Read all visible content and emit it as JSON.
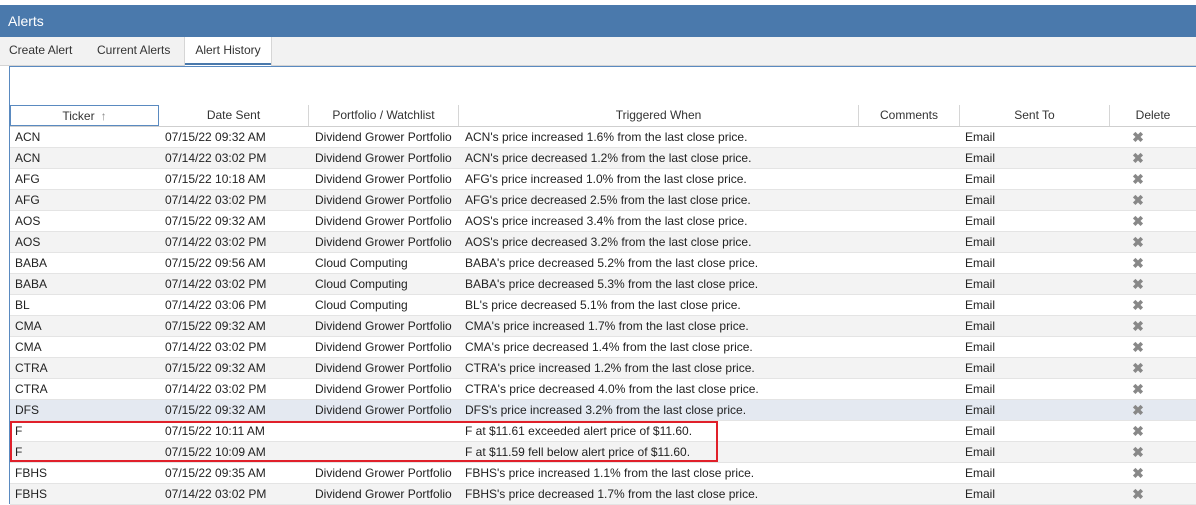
{
  "window": {
    "title": "Alerts"
  },
  "tabs": [
    {
      "label": "Create Alert",
      "active": false
    },
    {
      "label": "Current Alerts",
      "active": false
    },
    {
      "label": "Alert History",
      "active": true
    }
  ],
  "columns": {
    "ticker": "Ticker",
    "date_sent": "Date Sent",
    "portfolio": "Portfolio / Watchlist",
    "triggered": "Triggered When",
    "comments": "Comments",
    "sent_to": "Sent To",
    "delete": "Delete"
  },
  "sort": {
    "column": "Ticker",
    "direction": "ascending",
    "icon": "arrow-up-icon"
  },
  "delete_icon": "close-icon",
  "rows": [
    {
      "ticker": "ACN",
      "date": "07/15/22 09:32 AM",
      "portfolio": "Dividend Grower Portfolio",
      "triggered": "ACN's price increased 1.6% from the last close price.",
      "comments": "",
      "sent_to": "Email"
    },
    {
      "ticker": "ACN",
      "date": "07/14/22 03:02 PM",
      "portfolio": "Dividend Grower Portfolio",
      "triggered": "ACN's price decreased 1.2% from the last close price.",
      "comments": "",
      "sent_to": "Email"
    },
    {
      "ticker": "AFG",
      "date": "07/15/22 10:18 AM",
      "portfolio": "Dividend Grower Portfolio",
      "triggered": "AFG's price increased 1.0% from the last close price.",
      "comments": "",
      "sent_to": "Email"
    },
    {
      "ticker": "AFG",
      "date": "07/14/22 03:02 PM",
      "portfolio": "Dividend Grower Portfolio",
      "triggered": "AFG's price decreased 2.5% from the last close price.",
      "comments": "",
      "sent_to": "Email"
    },
    {
      "ticker": "AOS",
      "date": "07/15/22 09:32 AM",
      "portfolio": "Dividend Grower Portfolio",
      "triggered": "AOS's price increased 3.4% from the last close price.",
      "comments": "",
      "sent_to": "Email"
    },
    {
      "ticker": "AOS",
      "date": "07/14/22 03:02 PM",
      "portfolio": "Dividend Grower Portfolio",
      "triggered": "AOS's price decreased 3.2% from the last close price.",
      "comments": "",
      "sent_to": "Email"
    },
    {
      "ticker": "BABA",
      "date": "07/15/22 09:56 AM",
      "portfolio": "Cloud Computing",
      "triggered": "BABA's price decreased 5.2% from the last close price.",
      "comments": "",
      "sent_to": "Email"
    },
    {
      "ticker": "BABA",
      "date": "07/14/22 03:02 PM",
      "portfolio": "Cloud Computing",
      "triggered": "BABA's price decreased 5.3% from the last close price.",
      "comments": "",
      "sent_to": "Email"
    },
    {
      "ticker": "BL",
      "date": "07/14/22 03:06 PM",
      "portfolio": "Cloud Computing",
      "triggered": "BL's price decreased 5.1% from the last close price.",
      "comments": "",
      "sent_to": "Email"
    },
    {
      "ticker": "CMA",
      "date": "07/15/22 09:32 AM",
      "portfolio": "Dividend Grower Portfolio",
      "triggered": "CMA's price increased 1.7% from the last close price.",
      "comments": "",
      "sent_to": "Email"
    },
    {
      "ticker": "CMA",
      "date": "07/14/22 03:02 PM",
      "portfolio": "Dividend Grower Portfolio",
      "triggered": "CMA's price decreased 1.4% from the last close price.",
      "comments": "",
      "sent_to": "Email"
    },
    {
      "ticker": "CTRA",
      "date": "07/15/22 09:32 AM",
      "portfolio": "Dividend Grower Portfolio",
      "triggered": "CTRA's price increased 1.2% from the last close price.",
      "comments": "",
      "sent_to": "Email"
    },
    {
      "ticker": "CTRA",
      "date": "07/14/22 03:02 PM",
      "portfolio": "Dividend Grower Portfolio",
      "triggered": "CTRA's price decreased 4.0% from the last close price.",
      "comments": "",
      "sent_to": "Email"
    },
    {
      "ticker": "DFS",
      "date": "07/15/22 09:32 AM",
      "portfolio": "Dividend Grower Portfolio",
      "triggered": "DFS's price increased 3.2% from the last close price.",
      "comments": "",
      "sent_to": "Email",
      "highlighted": true
    },
    {
      "ticker": "F",
      "date": "07/15/22 10:11 AM",
      "portfolio": "",
      "triggered": "F at $11.61 exceeded alert price of $11.60.",
      "comments": "",
      "sent_to": "Email"
    },
    {
      "ticker": "F",
      "date": "07/15/22 10:09 AM",
      "portfolio": "",
      "triggered": "F at $11.59 fell below alert price of $11.60.",
      "comments": "",
      "sent_to": "Email"
    },
    {
      "ticker": "FBHS",
      "date": "07/15/22 09:35 AM",
      "portfolio": "Dividend Grower Portfolio",
      "triggered": "FBHS's price increased 1.1% from the last close price.",
      "comments": "",
      "sent_to": "Email"
    },
    {
      "ticker": "FBHS",
      "date": "07/14/22 03:02 PM",
      "portfolio": "Dividend Grower Portfolio",
      "triggered": "FBHS's price decreased 1.7% from the last close price.",
      "comments": "",
      "sent_to": "Email"
    }
  ],
  "colors": {
    "titlebar": "#4a79ac",
    "annotation_box": "#e0202a",
    "row_alt": "#f3f3f3",
    "row_highlight": "#e4e9f1"
  }
}
